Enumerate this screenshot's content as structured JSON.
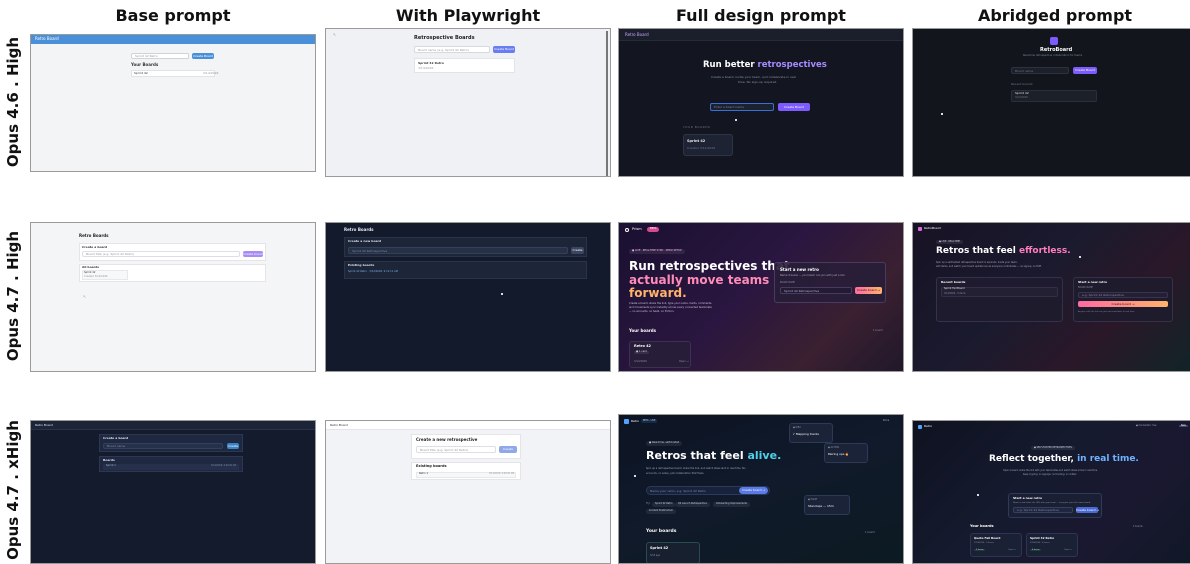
{
  "columns": [
    "Base prompt",
    "With Playwright",
    "Full design prompt",
    "Abridged prompt"
  ],
  "rows": [
    "Opus 4.6 . High",
    "Opus 4.7 . High",
    "Opus 4.7 . xHigh"
  ],
  "r1": {
    "base": {
      "topbar": "Retro Board",
      "input_ph": "Sprint 42 Retro",
      "button": "Create Board",
      "heading": "Your Boards",
      "item": "Sprint 42",
      "item_date": "3/14/2026"
    },
    "pw": {
      "title": "Retrospective Boards",
      "input_ph": "Board name (e.g. Sprint 42 Retro)",
      "button": "Create Board",
      "item": "Sprint 42 Retro",
      "item_date": "3/14/2026"
    },
    "full": {
      "brand": "Retro Board",
      "headline_plain": "Run better ",
      "headline_accent": "retrospectives",
      "sub_1": "Create a board, invite your team, and collaborate in real",
      "sub_2": "time. No sign-up required.",
      "input_ph": "Enter a board name",
      "button": "Create Board",
      "section": "YOUR BOARDS",
      "card_title": "Sprint 42",
      "card_sub": "Created 3/14/2026"
    },
    "abr": {
      "brand": "RetroBoard",
      "tagline": "Real-time retrospective collaboration for teams",
      "input_ph": "Board name",
      "button": "Create Board",
      "section": "Recent boards",
      "item": "Sprint 42",
      "item_date": "3/14/2026"
    }
  },
  "r2": {
    "base": {
      "title": "Retro Boards",
      "create_label": "Create a board",
      "input_ph": "Board title (e.g. Sprint 42 Retro)",
      "button": "Create board",
      "section": "All boards",
      "item": "Sprint 42",
      "item_date": "Created 3/14/2026"
    },
    "pw": {
      "title": "Retro Boards",
      "create_label": "Create a new board",
      "input_ph": "Sprint 42 Retrospective",
      "button": "Create",
      "section": "Existing boards",
      "item": "Sprint 42 Retro · 3/14/2026, 9:12:11 AM"
    },
    "full": {
      "brand": "Prism",
      "badge": "BETA",
      "pill": "● LIVE · REAL-TIME SYNC · ZERO SETUP",
      "h1": "Run retrospectives that",
      "h2": "actually move teams",
      "h3": "forward.",
      "sub_1": "Create a board, share the link, type your name. Cards, comments,",
      "sub_2": "and movements sync instantly across every connected teammate",
      "sub_3": "— no accounts, no SaaS, no friction.",
      "panel_title": "Start a new retro",
      "panel_sub": "Name it below — your team can join with just a link.",
      "panel_label": "BOARD NAME",
      "panel_input": "Sprint 42 Retrospective",
      "panel_button": "Create board →",
      "section": "Your boards",
      "section_count": "1 board",
      "card_title": "Retro 42",
      "card_badge": "● 1 card",
      "card_date": "3/14/2026",
      "card_open": "Open →"
    },
    "abr": {
      "brand": "RetroBoard",
      "pill": "● LIVE · REAL-TIME",
      "h_plain": "Retros that feel ",
      "h_accent": "effortless.",
      "sub_1": "Spin up a self-hosted retrospective board in seconds. Invite your team,",
      "sub_2": "add items, and watch your board update live as everyone contributes — no signup, no fluff.",
      "left_title": "Recent boards",
      "left_item": "Sprint Fail Board",
      "left_item_date": "3/14/2026 · 0 items",
      "right_title": "Start a new retro",
      "right_label": "BOARD NAME",
      "right_input": "e.g. Sprint 42 Retrospective",
      "right_button": "Create board →",
      "right_note": "Anyone with the link can join and contribute in real time."
    }
  },
  "r3": {
    "base": {
      "topbar": "Retro Board",
      "create_label": "Create a board",
      "input_ph": "Board name",
      "button": "Create",
      "section": "Boards",
      "item": "Sprint 1",
      "item_date": "3/14/2026, 9:00:00 AM"
    },
    "pw": {
      "topbar": "Retro Board",
      "title": "Create a new retrospective",
      "input_ph": "Board title (e.g. Sprint 42 Retro)",
      "button": "Create",
      "section": "Existing boards",
      "item": "Retro 1",
      "item_date": "3/14/2026, 9:00:00 AM"
    },
    "full": {
      "brand": "Retro",
      "badge": "BETA · LIVE",
      "nav_right": "Docs",
      "pill": "● Real-time, self-hosted",
      "h_plain": "Retros that feel ",
      "h_accent": "alive.",
      "sub_1": "Spin up a retrospective board, share the link, and watch ideas land in real time. No",
      "sub_2": "accounts, no setup, just collaboration that flows.",
      "input_ph": "Name your retro, e.g. Sprint 42 Retro",
      "button": "Create board →",
      "try_label": "Try:",
      "chip_1": "Sprint 42 Retro",
      "chip_2": "Q4 Launch Retrospective",
      "chip_3": "Onboarding Improvements",
      "chip_4": "Incident Postmortem",
      "float_1_tag": "● IDEA",
      "float_1_text": "♪ Mapping tracks",
      "float_2_tag": "● ACTION",
      "float_2_text": "Pairing ops 🔥",
      "float_3_tag": "● ISSUE",
      "float_3_text": "Standups — 15m",
      "section": "Your boards",
      "section_count": "1 board",
      "card_title": "Sprint 42",
      "card_sub": "3/14 ago"
    },
    "abr": {
      "brand": "Retro",
      "nav_1": "● Connected · live",
      "nav_2": "New",
      "pill": "● SELF-HOSTED RETROSPECTIVES",
      "h_plain": "Reflect together, ",
      "h_accent": "in real time.",
      "sub_1": "Open a board, share the link with your teammates and watch ideas arrive in real time.",
      "sub_2": "Keep it going: no signups, no tracking, no clutter.",
      "panel_title": "Start a new retro",
      "panel_sub": "Name it and share the URL with your team — everyone joins the same board.",
      "panel_input": "e.g. Sprint 42 Retrospective",
      "panel_button": "Create board →",
      "section": "Your boards",
      "section_count": "2 boards",
      "card_1_title": "Quote Fail Board",
      "card_1_date": "3/14/2026 · 0 items",
      "card_1_tag": "3 items",
      "card_1_open": "Open →",
      "card_2_title": "Sprint 42 Retro",
      "card_2_date": "3/14/2026 · 4 items",
      "card_2_tag": "4 items",
      "card_2_open": "Open →"
    }
  },
  "colors": {
    "blue_topbar": "#4a90d9",
    "accent_purple": "#7c5cff",
    "accent_gradient_start": "#ff6aa0",
    "accent_gradient_end": "#ffb36b",
    "cyan": "#4fd1e8"
  }
}
